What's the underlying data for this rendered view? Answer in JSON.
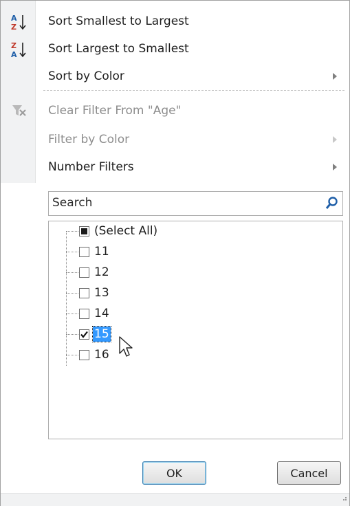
{
  "menu": {
    "sort_asc": "Sort Smallest to Largest",
    "sort_desc": "Sort Largest to Smallest",
    "sort_by_color": "Sort by Color",
    "clear_filter": "Clear Filter From \"Age\"",
    "filter_by_color": "Filter by Color",
    "number_filters": "Number Filters"
  },
  "search": {
    "placeholder": "Search",
    "value": ""
  },
  "tree": {
    "items": [
      {
        "label": "(Select All)",
        "state": "partial"
      },
      {
        "label": "11",
        "state": "unchecked"
      },
      {
        "label": "12",
        "state": "unchecked"
      },
      {
        "label": "13",
        "state": "unchecked"
      },
      {
        "label": "14",
        "state": "unchecked"
      },
      {
        "label": "15",
        "state": "checked"
      },
      {
        "label": "16",
        "state": "unchecked"
      }
    ]
  },
  "buttons": {
    "ok": "OK",
    "cancel": "Cancel"
  },
  "icons": {
    "sort_asc": "sort-a-to-z-icon",
    "sort_desc": "sort-z-to-a-icon",
    "clear_filter": "clear-filter-icon",
    "search": "search-icon"
  },
  "colors": {
    "selection": "#3399ff",
    "disabled_text": "#8d8d8d",
    "search_icon": "#1f5fa8"
  }
}
